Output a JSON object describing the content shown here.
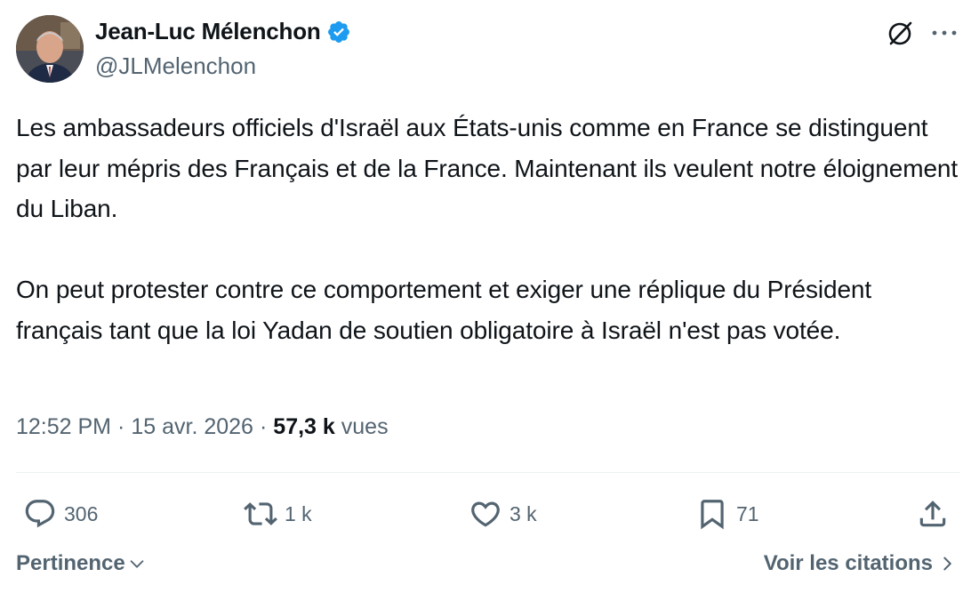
{
  "author": {
    "name": "Jean-Luc Mélenchon",
    "handle": "@JLMelenchon",
    "verified": true,
    "verified_color": "#1d9bf0"
  },
  "tweet": {
    "paragraphs": [
      "Les ambassadeurs officiels d'Israël aux États-unis comme en France se distinguent par leur mépris des Français et de la France. Maintenant ils veulent notre éloignement du Liban.",
      "On peut protester contre ce comportement et exiger une réplique du Président français tant que la loi Yadan de soutien obligatoire à Israël n'est pas votée."
    ],
    "time": "12:52 PM",
    "separator": "·",
    "date": "15 avr. 2026",
    "views_count": "57,3 k",
    "views_label": "vues"
  },
  "actions": {
    "replies": "306",
    "reposts": "1 k",
    "likes": "3 k",
    "bookmarks": "71"
  },
  "footer": {
    "sort_label": "Pertinence",
    "quotes_label": "Voir les citations"
  },
  "icons": {
    "grok": "grok-icon",
    "more": "more-icon",
    "reply": "reply-icon",
    "repost": "repost-icon",
    "like": "like-icon",
    "bookmark": "bookmark-icon",
    "share": "share-icon"
  },
  "colors": {
    "text": "#0f1419",
    "secondary": "#536471",
    "divider": "#eff3f4",
    "accent": "#1d9bf0"
  }
}
